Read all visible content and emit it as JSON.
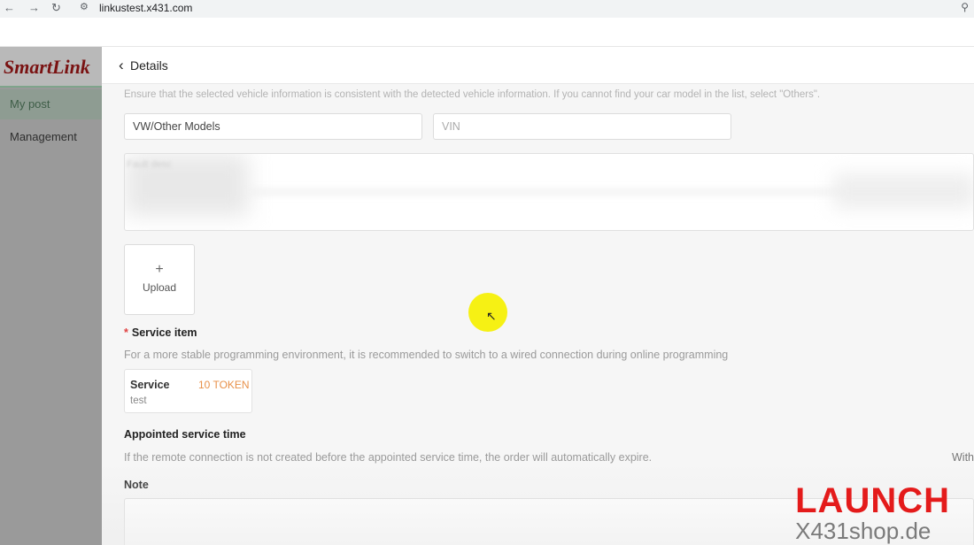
{
  "browser": {
    "url": "linkustest.x431.com"
  },
  "sidebar": {
    "logo_text": "SmartLink",
    "items": [
      {
        "label": "My post"
      },
      {
        "label": "Management"
      }
    ]
  },
  "header": {
    "title": "Details"
  },
  "vehicle": {
    "hint": "Ensure that the selected vehicle information is consistent with the detected vehicle information. If you cannot find your car model in the list, select \"Others\".",
    "model_value": "VW/Other Models",
    "vin_placeholder": "VIN"
  },
  "fault": {
    "label": "Fault desc"
  },
  "upload": {
    "plus": "+",
    "label": "Upload"
  },
  "service_item": {
    "title": "Service item",
    "hint": "For a more stable programming environment, it is recommended to switch to a wired connection during online programming",
    "card": {
      "name": "Service",
      "price": "10 TOKEN",
      "description": "test"
    }
  },
  "appointed_time": {
    "title": "Appointed service time",
    "hint": "If the remote connection is not created before the appointed service time, the order will automatically expire.",
    "right_text": "With"
  },
  "note": {
    "title": "Note"
  },
  "watermark": {
    "brand": "LAUNCH",
    "site": "X431shop.de"
  },
  "colors": {
    "sidebar_bg": "#9a9a9a",
    "token_price": "#e8914a",
    "required_star": "#e04040",
    "watermark_red": "#e41b1b",
    "cursor_highlight": "#f5f000"
  }
}
